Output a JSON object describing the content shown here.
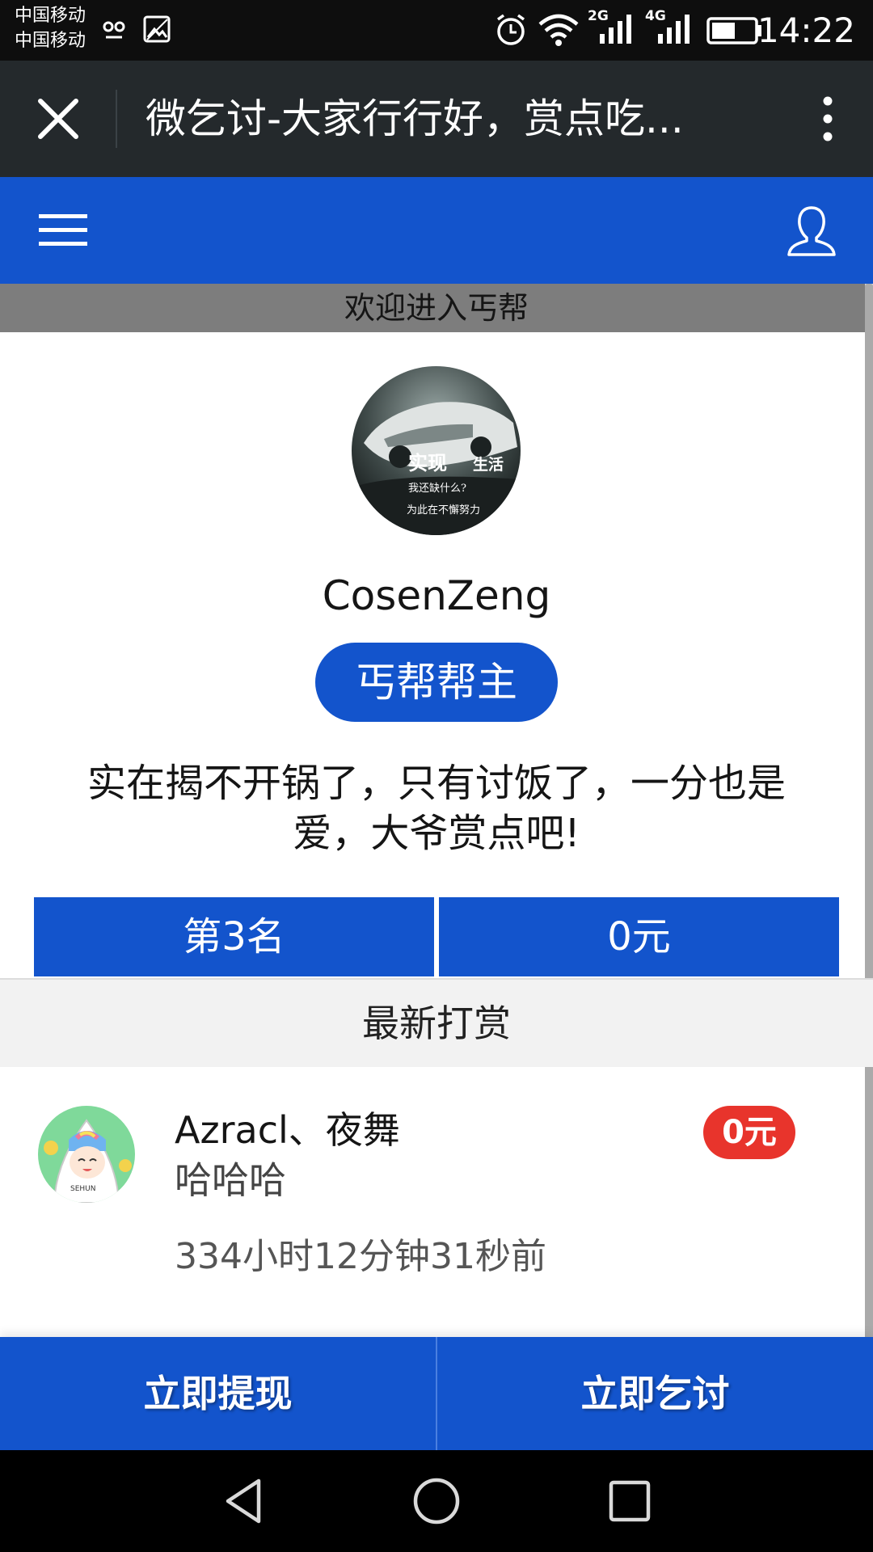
{
  "status_bar": {
    "carrier_1": "中国移动",
    "carrier_2": "中国移动",
    "network_1": "2G",
    "network_2": "4G",
    "time": "14:22"
  },
  "titlebar": {
    "title": "微乞讨-大家行行好，赏点吃..."
  },
  "welcome": {
    "text": "欢迎进入丐帮"
  },
  "profile": {
    "username": "CosenZeng",
    "rank_title": "丐帮帮主",
    "slogan": "实在揭不开锅了，只有讨饭了，一分也是爱，大爷赏点吧!",
    "avatar_caption_lines": [
      "实现",
      "生活",
      "我还缺什么?",
      "为此在不懈努力"
    ]
  },
  "stats": {
    "rank": "第3名",
    "amount": "0元"
  },
  "tips_section": {
    "header": "最新打赏",
    "items": [
      {
        "name": "Azracl、夜舞",
        "message": "哈哈哈",
        "time": "334小时12分钟31秒前",
        "amount": "0元"
      }
    ]
  },
  "actions": {
    "withdraw": "立即提现",
    "beg": "立即乞讨"
  },
  "colors": {
    "primary_blue": "#1354cc",
    "amount_red": "#e8342c",
    "titlebar_dark": "#24292c"
  }
}
